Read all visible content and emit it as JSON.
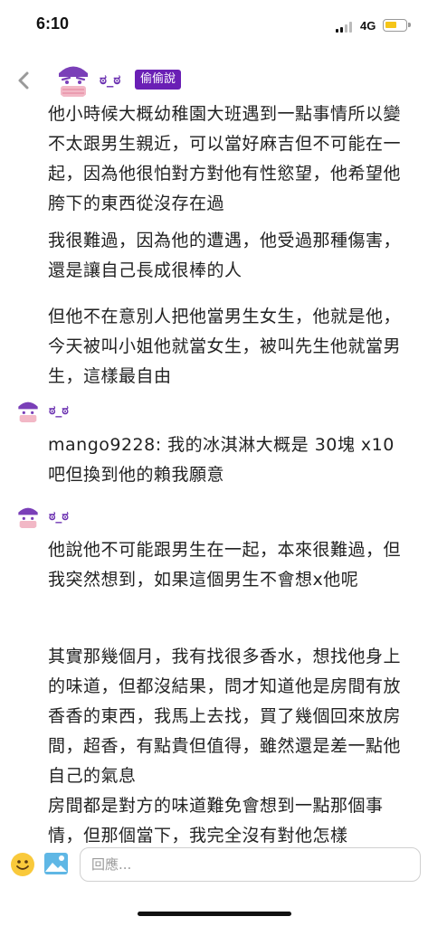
{
  "status_bar": {
    "time": "6:10",
    "network": "4G"
  },
  "header": {
    "name": "ಠ_ಠ",
    "badge": "偷偷說"
  },
  "post": {
    "paragraphs": [
      "他小時候大概幼稚園大班遇到一點事情所以變不太跟男生親近，可以當好麻吉但不可能在一起，因為他很怕對方對他有性慾望，他希望他胯下的東西從沒存在過",
      "我很難過，因為他的遭遇，他受過那種傷害，還是讓自己長成很棒的人",
      "但他不在意別人把他當男生女生，他就是他，今天被叫小姐他就當女生，被叫先生他就當男生，這樣最自由"
    ]
  },
  "comments": [
    {
      "name": "ಠ_ಠ",
      "text": "mango9228: 我的冰淇淋大概是 30塊 x10 吧但換到他的賴我願意"
    },
    {
      "name": "ಠ_ಠ",
      "text": "他說他不可能跟男生在一起，本來很難過，但我突然想到，如果這個男生不會想x他呢"
    }
  ],
  "trailing_paragraphs": [
    "其實那幾個月，我有找很多香水，想找他身上的味道，但都沒結果，問才知道他是房間有放香香的東西，我馬上去找，買了幾個回來放房間，超香，有點貴但值得，雖然還是差一點他自己的氣息",
    "房間都是對方的味道難免會想到一點那個事情，但那個當下，我完全沒有對他怎樣"
  ],
  "reply_bar": {
    "placeholder": "回應..."
  },
  "icons": {
    "back": "chevron-left-icon",
    "emoji": "smiley-icon",
    "image": "image-icon"
  },
  "colors": {
    "accent_purple": "#6a2fb0",
    "badge_bg": "#6a1fb5",
    "avatar_pink": "#f2b8c6"
  }
}
